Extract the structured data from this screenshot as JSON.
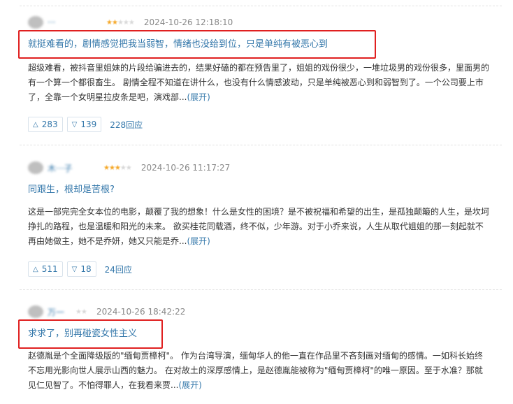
{
  "reviews": [
    {
      "username": "···",
      "time": "2024-10-26 12:18:10",
      "title": "就挺难看的，剧情感觉把我当弱智，情绪也没给到位，只是单纯有被恶心到",
      "body": "超级难看，被抖音里姐妹的片段给骗进去的，结果好磕的都在预告里了，姐姐的戏份很少，一堆垃圾男的戏份很多，里面男的有一个算一个都很畜生。 剧情全程不知道在讲什么，也没有什么情感波动，只是单纯被恶心到和弱智到了。一个公司要上市了，全靠一个女明星拉皮条是吧，演戏部...",
      "expand": "(展开)",
      "up": "283",
      "down": "139",
      "replies": "228回应"
    },
    {
      "username": "木···子",
      "time": "2024-10-26 11:17:27",
      "title": "同跟生，根却是苦根?",
      "body": "这是一部完完全女本位的电影，颠覆了我的想象！什么是女性的困境？是不被祝福和希望的出生，是孤独颠簸的人生，是坎坷挣扎的路程，也是温暖和阳光的未来。 欲买桂花同载酒，终不似，少年游。对于小乔来说，人生从取代姐姐的那一刻起就不再由她做主，她不是乔妍，她又只能是乔...",
      "expand": "(展开)",
      "up": "511",
      "down": "18",
      "replies": "24回应"
    },
    {
      "username": "万一",
      "time": "2024-10-26 18:42:22",
      "title": "求求了，别再碰瓷女性主义",
      "body": "赵德胤是个全面降级版的\"缅甸贾樟柯\"。 作为台湾导演，缅甸华人的他一直在作品里不吝刻画对缅甸的感情。一如科长始终不忘用光影向世人展示山西的魅力。 在对故土的深厚感情上，是赵德胤能被称为\"缅甸贾樟柯\"的唯一原因。至于水准？那就见仁见智了。不怕得罪人，在我看来贾...",
      "expand": "(展开)"
    }
  ],
  "colors": {
    "link": "#3377aa",
    "highlight": "#e02020",
    "star": "#f5a623"
  },
  "icons": {
    "up": "triangle-up-icon",
    "down": "triangle-down-icon"
  }
}
